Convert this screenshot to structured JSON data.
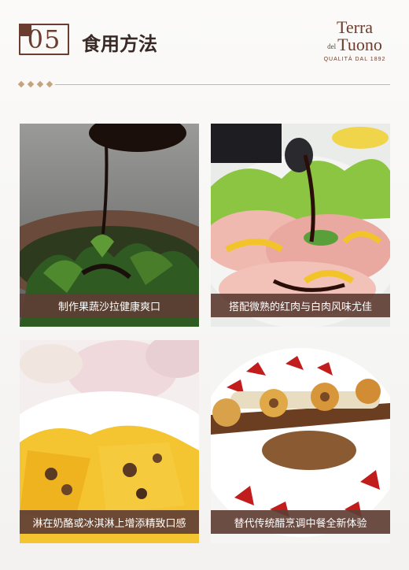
{
  "header": {
    "section_number": "05",
    "section_title": "食用方法"
  },
  "brand": {
    "name_line1": "Terra",
    "name_del": "del",
    "name_line2": "Tuono",
    "tagline": "QUALITÀ DAL 1892"
  },
  "cards": [
    {
      "caption": "制作果蔬沙拉健康爽口"
    },
    {
      "caption": "搭配微熟的红肉与白肉风味尤佳"
    },
    {
      "caption": "淋在奶酪或冰淇淋上增添精致口感"
    },
    {
      "caption": "替代传统醋烹调中餐全新体验"
    }
  ],
  "colors": {
    "accent": "#6b3d2e",
    "caption_bg": "#5e3e34",
    "divider": "#c4a47e"
  }
}
